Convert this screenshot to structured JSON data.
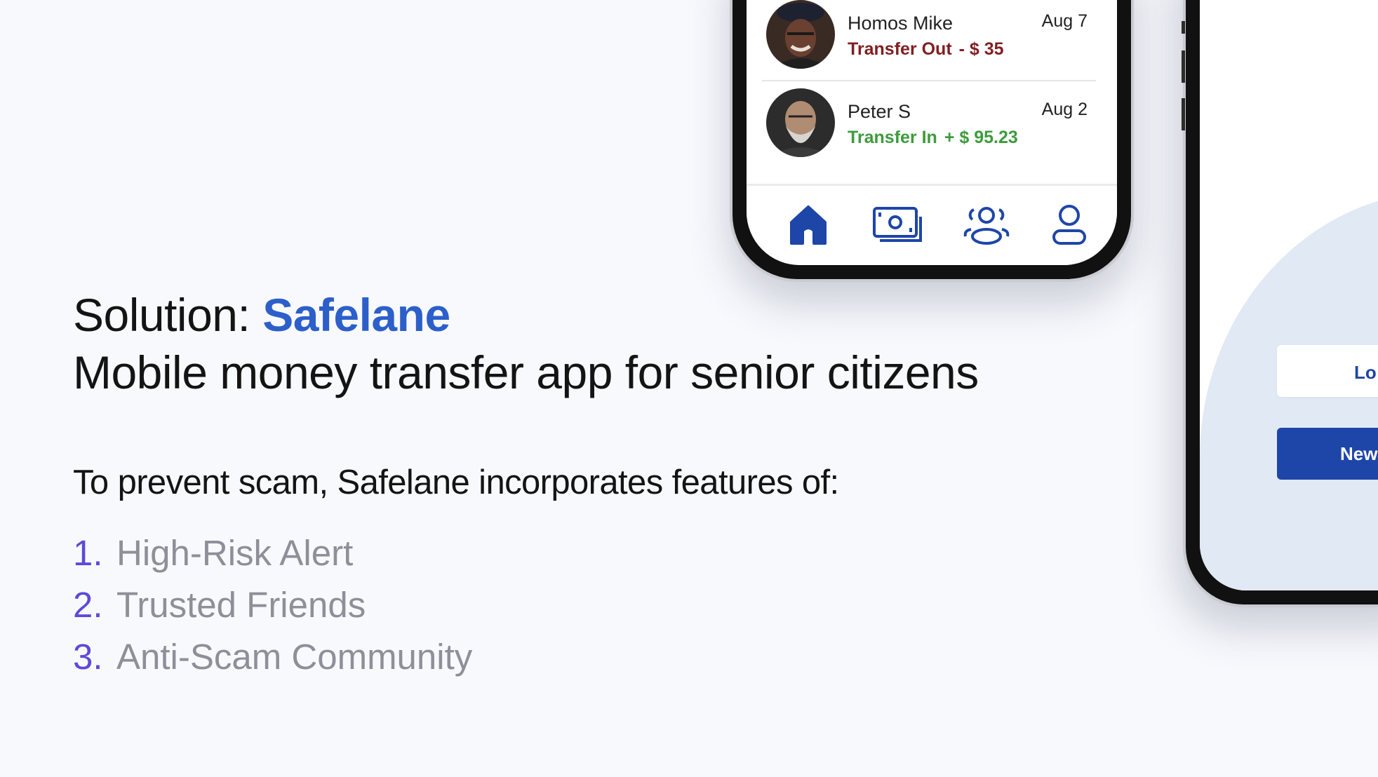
{
  "headline": {
    "prefix": "Solution: ",
    "brand": "Safelane",
    "tagline": "Mobile money transfer app for senior citizens"
  },
  "intro": "To prevent scam, Safelane incorporates features of:",
  "features": [
    {
      "num": "1.",
      "label": "High-Risk Alert"
    },
    {
      "num": "2.",
      "label": "Trusted Friends"
    },
    {
      "num": "3.",
      "label": "Anti-Scam Community"
    }
  ],
  "phone1": {
    "transactions": [
      {
        "name": "Homos Mike",
        "date": "Aug 7",
        "type": "Transfer Out",
        "amount": "- $ 35",
        "direction": "out"
      },
      {
        "name": "Peter S",
        "date": "Aug 2",
        "type": "Transfer In",
        "amount": "+ $ 95.23",
        "direction": "in"
      }
    ],
    "tabs": [
      {
        "icon": "home-icon"
      },
      {
        "icon": "money-icon"
      },
      {
        "icon": "community-icon"
      },
      {
        "icon": "profile-icon"
      }
    ]
  },
  "phone2": {
    "login_label": "Lo",
    "new_label": "New"
  },
  "colors": {
    "brand": "#2c5fca",
    "out": "#7f1f22",
    "in": "#3e9b3c",
    "icon": "#1e46a8",
    "number": "#5b4bd8",
    "feature_text": "#8d8f99"
  }
}
